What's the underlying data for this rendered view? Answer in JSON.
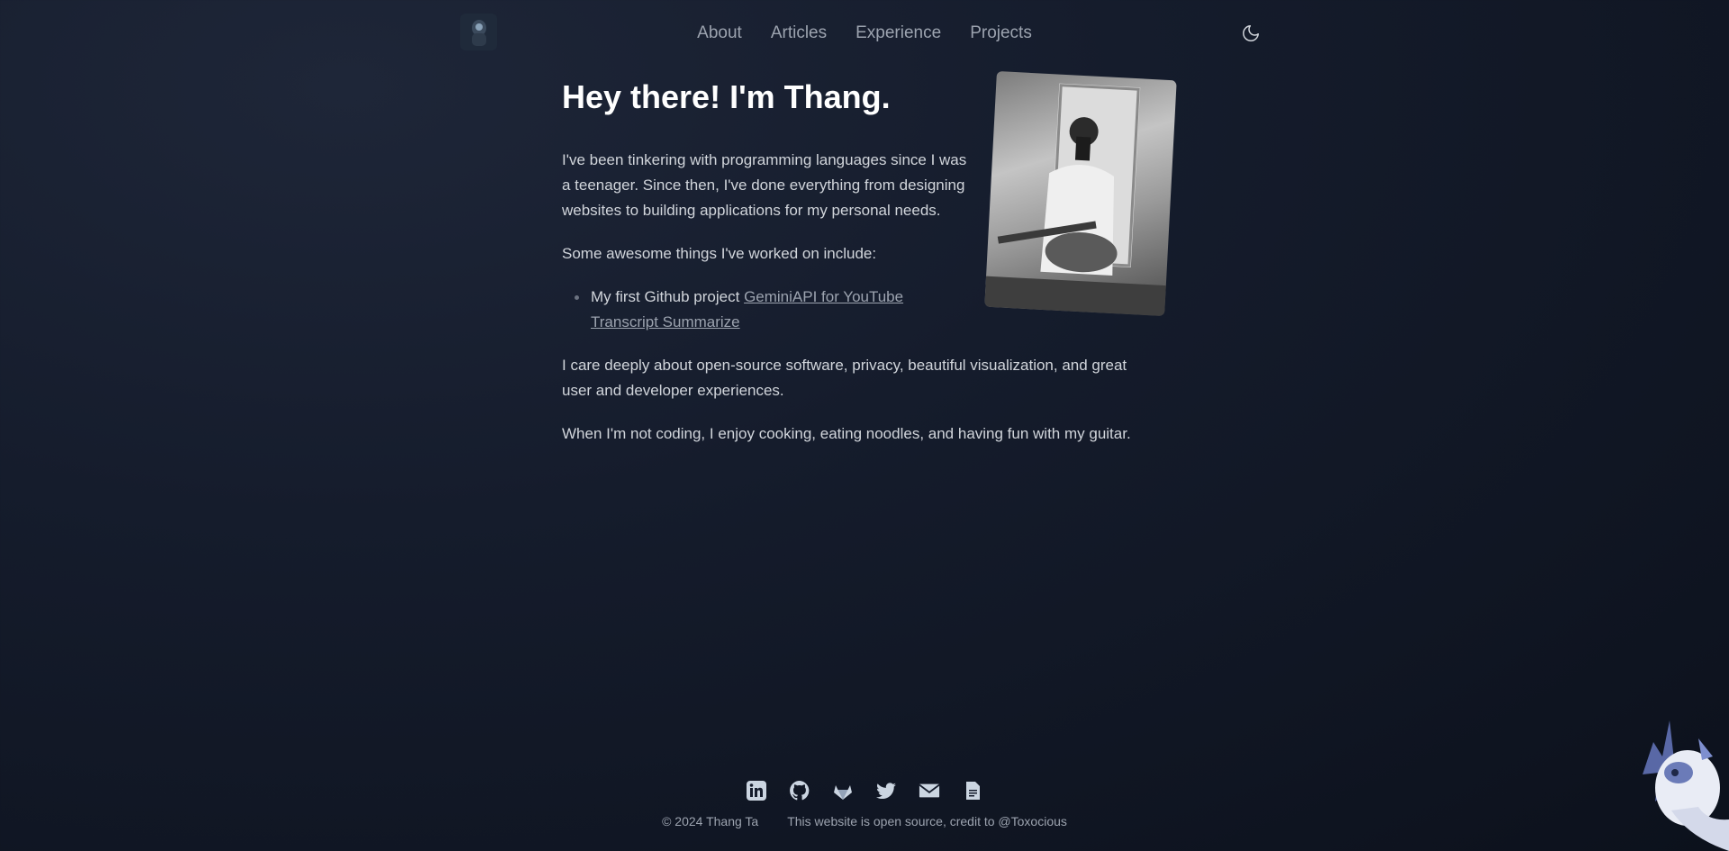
{
  "header": {
    "nav": [
      "About",
      "Articles",
      "Experience",
      "Projects"
    ],
    "logo_icon": "avatar-logo",
    "theme_icon": "moon-icon"
  },
  "main": {
    "title": "Hey there! I'm Thang.",
    "intro": "I've been tinkering with programming languages since I was a teenager. Since then, I've done everything from designing websites to building applications for my personal needs.",
    "awesome_intro": "Some awesome things I've worked on include:",
    "list": [
      {
        "prefix": "My first Github project ",
        "link_text": "GeminiAPI for YouTube Transcript Summarize"
      }
    ],
    "care": "I care deeply about open-source software, privacy, beautiful visualization, and great user and developer experiences.",
    "hobbies": "When I'm not coding, I enjoy cooking, eating noodles, and having fun with my guitar."
  },
  "footer": {
    "social_icons": [
      "linkedin-icon",
      "github-icon",
      "gitlab-icon",
      "twitter-icon",
      "mail-icon",
      "resume-icon"
    ],
    "copyright": "© 2024 Thang Ta",
    "credit": "This website is open source, credit to @Toxocious"
  },
  "colors": {
    "background": "#151c2c",
    "text": "#d1d5db",
    "muted": "#9ca3af",
    "heading": "#ffffff"
  }
}
